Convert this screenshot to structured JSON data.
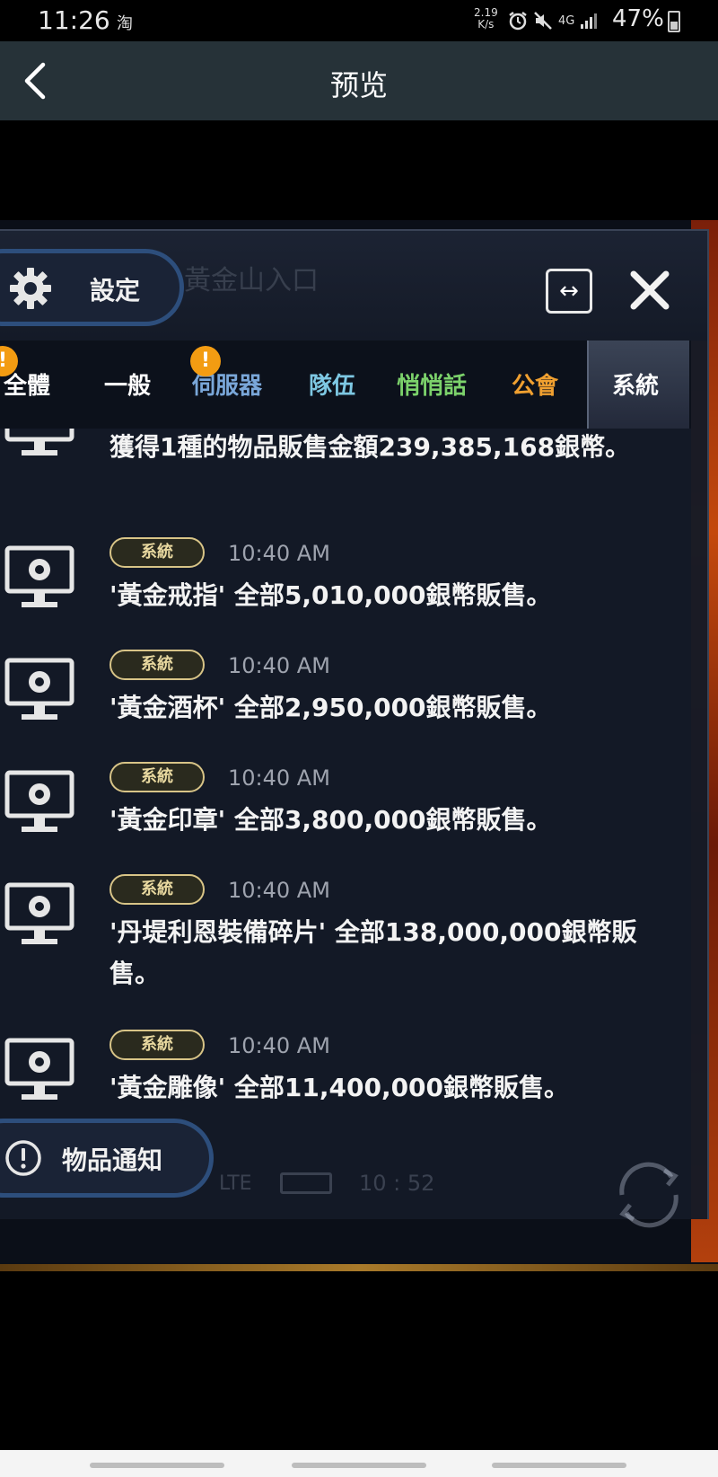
{
  "status_bar": {
    "time": "11:26",
    "taobao": "淘",
    "net_speed_value": "2.19",
    "net_speed_unit": "K/s",
    "network": "4G",
    "battery": "47%"
  },
  "title_bar": {
    "title": "预览"
  },
  "game": {
    "ghost_location": "黃金山入口",
    "settings_label": "設定",
    "expand_symbol": "↔",
    "tabs": [
      {
        "label": "全體",
        "color": "#ffffff"
      },
      {
        "label": "一般",
        "color": "#ffffff"
      },
      {
        "label": "伺服器",
        "color": "#7aa7d9"
      },
      {
        "label": "隊伍",
        "color": "#7ec8e3"
      },
      {
        "label": "悄悄話",
        "color": "#7cd26b"
      },
      {
        "label": "公會",
        "color": "#f0a030"
      },
      {
        "label": "系統",
        "color": "#ffffff"
      }
    ],
    "badge_symbol": "!",
    "messages": [
      {
        "text": "獲得1種的物品販售金額239,385,168銀幣。"
      },
      {
        "tag": "系統",
        "time": "10:40 AM",
        "text": "'黃金戒指' 全部5,010,000銀幣販售。"
      },
      {
        "tag": "系統",
        "time": "10:40 AM",
        "text": "'黃金酒杯' 全部2,950,000銀幣販售。"
      },
      {
        "tag": "系統",
        "time": "10:40 AM",
        "text": "'黃金印章' 全部3,800,000銀幣販售。"
      },
      {
        "tag": "系統",
        "time": "10:40 AM",
        "text": "'丹堤利恩裝備碎片' 全部138,000,000銀幣販售。"
      },
      {
        "tag": "系統",
        "time": "10:40 AM",
        "text": "'黃金雕像' 全部11,400,000銀幣販售。"
      }
    ],
    "notification_label": "物品通知",
    "ghost_network": "LTE",
    "ghost_clock": "10 : 52"
  }
}
